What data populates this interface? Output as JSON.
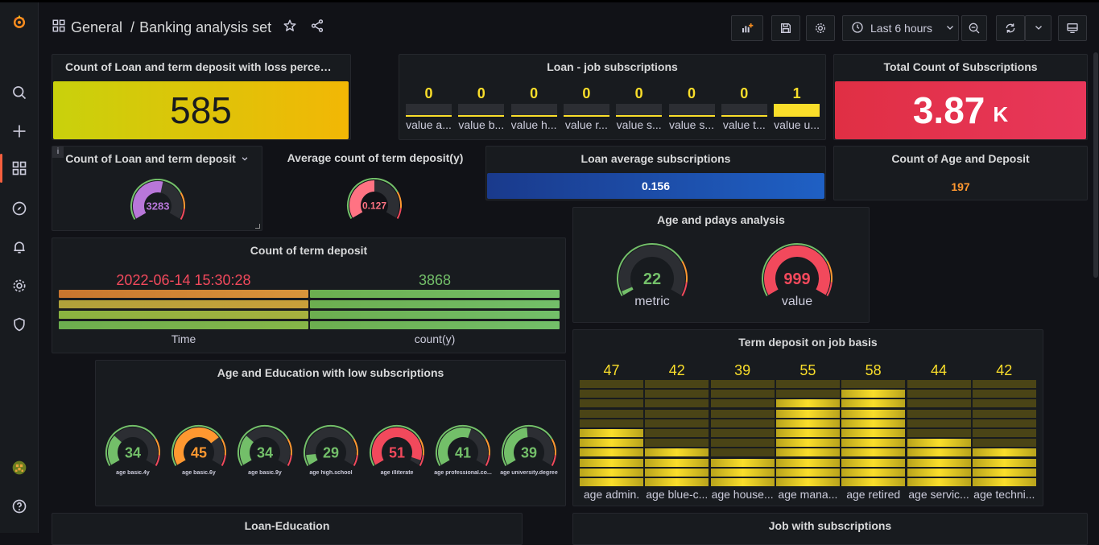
{
  "breadcrumb": {
    "folder": "General",
    "separator": "/",
    "dashboard": "Banking analysis set"
  },
  "toolbar": {
    "time_range": "Last 6 hours"
  },
  "panels": {
    "loss": {
      "title": "Count of Loan and term deposit with loss percenta...",
      "value": "585",
      "colors": [
        "#c9d10c",
        "#f2b705"
      ]
    },
    "loanjob": {
      "title": "Loan - job subscriptions",
      "items": [
        {
          "label": "value a...",
          "value": "0"
        },
        {
          "label": "value b...",
          "value": "0"
        },
        {
          "label": "value h...",
          "value": "0"
        },
        {
          "label": "value r...",
          "value": "0"
        },
        {
          "label": "value s...",
          "value": "0"
        },
        {
          "label": "value s...",
          "value": "0"
        },
        {
          "label": "value t...",
          "value": "0"
        },
        {
          "label": "value u...",
          "value": "1"
        }
      ],
      "color": "#fade2a"
    },
    "total": {
      "title": "Total Count of Subscriptions",
      "value": "3.87",
      "unit": "K",
      "color": "#e02f44"
    },
    "loan_term": {
      "title": "Count of Loan and term deposit",
      "value": "3283",
      "fraction": 0.55,
      "color": "#b877d9"
    },
    "avg_term": {
      "title": "Average count of term deposit(y)",
      "value": "0.127",
      "fraction": 0.5,
      "color": "#ff7383"
    },
    "loan_avg": {
      "title": "Loan average subscriptions",
      "value": "0.156",
      "color": "#1f60c4"
    },
    "age_deposit": {
      "title": "Count of Age and Deposit",
      "value": "197",
      "color": "#ff9830"
    },
    "age_pdays": {
      "title": "Age and pdays analysis",
      "gauges": [
        {
          "value": "22",
          "label": "metric",
          "fraction": 0.03,
          "color": "#73bf69"
        },
        {
          "value": "999",
          "label": "value",
          "fraction": 1.0,
          "color": "#f2495c"
        }
      ]
    },
    "count_term": {
      "title": "Count of term deposit",
      "items": [
        {
          "value": "2022-06-14 15:30:28",
          "label": "Time",
          "color": "#f2495c"
        },
        {
          "value": "3868",
          "label": "count(y)",
          "color": "#73bf69"
        }
      ]
    },
    "term_job": {
      "title": "Term deposit on job basis",
      "items": [
        {
          "value": "47",
          "label": "age admin."
        },
        {
          "value": "42",
          "label": "age blue-c..."
        },
        {
          "value": "39",
          "label": "age house..."
        },
        {
          "value": "55",
          "label": "age mana..."
        },
        {
          "value": "58",
          "label": "age retired"
        },
        {
          "value": "44",
          "label": "age servic..."
        },
        {
          "value": "42",
          "label": "age techni..."
        }
      ],
      "color": "#fade2a"
    },
    "age_edu": {
      "title": "Age and Education with low subscriptions",
      "gauges": [
        {
          "value": "34",
          "label": "age basic.4y",
          "fraction": 0.3,
          "color": "#73bf69"
        },
        {
          "value": "45",
          "label": "age basic.6y",
          "fraction": 0.72,
          "color": "#ff9830"
        },
        {
          "value": "34",
          "label": "age basic.9y",
          "fraction": 0.3,
          "color": "#73bf69"
        },
        {
          "value": "29",
          "label": "age high.school",
          "fraction": 0.1,
          "color": "#73bf69"
        },
        {
          "value": "51",
          "label": "age illiterate",
          "fraction": 0.95,
          "color": "#f2495c"
        },
        {
          "value": "41",
          "label": "age professional.co...",
          "fraction": 0.58,
          "color": "#73bf69"
        },
        {
          "value": "39",
          "label": "age university.degree",
          "fraction": 0.48,
          "color": "#73bf69"
        }
      ]
    },
    "loan_edu": {
      "title": "Loan-Education"
    },
    "job_subs": {
      "title": "Job with subscriptions"
    }
  }
}
